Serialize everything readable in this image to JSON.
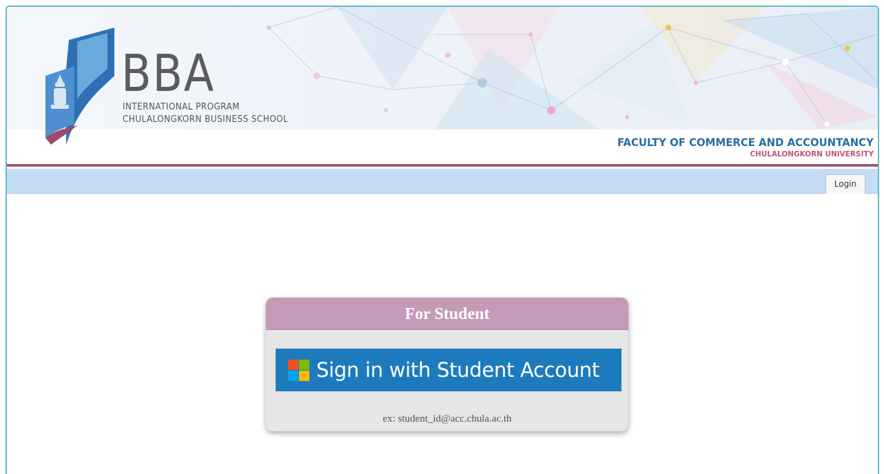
{
  "header": {
    "brand": "BBA",
    "program": "INTERNATIONAL PROGRAM",
    "school": "CHULALONGKORN BUSINESS SCHOOL",
    "faculty": "FACULTY OF COMMERCE AND ACCOUNTANCY",
    "university": "CHULALONGKORN UNIVERSITY"
  },
  "nav": {
    "login_tab": "Login"
  },
  "login_box": {
    "title": "For Student",
    "signin_label": "Sign in with Student Account",
    "hint": "ex: student_id@acc.chula.ac.th"
  },
  "colors": {
    "frame_border": "#5fbcc4",
    "nav_bg": "#c5dcf6",
    "box_header": "#c39ab8",
    "signin_btn": "#1d7bbd",
    "faculty_blue": "#2a6ea6",
    "university_pink": "#c2507e",
    "ms_red": "#f25022",
    "ms_green": "#7fba00",
    "ms_blue": "#00a4ef",
    "ms_yellow": "#ffb900"
  }
}
